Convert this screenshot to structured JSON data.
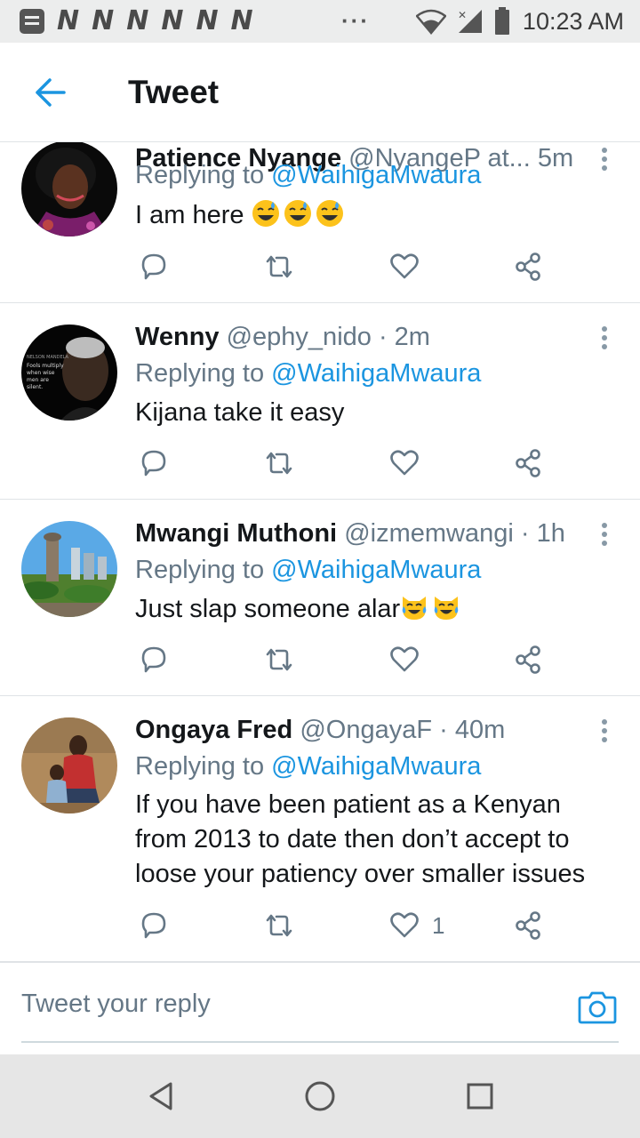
{
  "status_bar": {
    "notification_letters": [
      "N",
      "N",
      "N",
      "N",
      "N",
      "N"
    ],
    "overflow": "···",
    "time": "10:23 AM",
    "icons": [
      "notes-icon",
      "wifi-icon",
      "signal-icon",
      "battery-icon"
    ]
  },
  "app_bar": {
    "title": "Tweet",
    "back_icon": "back-arrow-icon"
  },
  "colors": {
    "accent": "#1b95e0",
    "text_primary": "#14171a",
    "text_secondary": "#657786",
    "divider": "#dfe3e6"
  },
  "tweets": [
    {
      "name": "Patience Nyange",
      "handle": "@NyangeP at...",
      "time": "5m",
      "replying_label": "Replying to",
      "replying_to": "@WaihigaMwaura",
      "text": "I am here",
      "emojis": [
        "sweat-smile-emoji",
        "sweat-smile-emoji",
        "sweat-smile-emoji"
      ],
      "like_count": ""
    },
    {
      "name": "Wenny",
      "handle": "@ephy_nido",
      "time": "· 2m",
      "replying_label": "Replying to",
      "replying_to": "@WaihigaMwaura",
      "text": "Kijana take it easy",
      "avatar_caption": "Fools multiply when wise men are silent.",
      "avatar_header": "NELSON MANDELA",
      "like_count": ""
    },
    {
      "name": "Mwangi Muthoni",
      "handle": "@izmemwangi",
      "time": "· 1h",
      "replying_label": "Replying to",
      "replying_to": "@WaihigaMwaura",
      "text": "Just slap someone alar",
      "emojis": [
        "cat-joy-emoji",
        "cat-joy-emoji"
      ],
      "like_count": ""
    },
    {
      "name": "Ongaya Fred",
      "handle": "@OngayaF",
      "time": "· 40m",
      "replying_label": "Replying to",
      "replying_to": "@WaihigaMwaura",
      "text": "If you have been patient as a Kenyan from 2013 to date then don’t accept to loose your patiency over smaller issues",
      "like_count": "1"
    }
  ],
  "composer": {
    "placeholder": "Tweet your reply",
    "camera_icon": "camera-icon"
  },
  "nav_bar": {
    "buttons": [
      "back-triangle-icon",
      "home-circle-icon",
      "recents-square-icon"
    ]
  }
}
